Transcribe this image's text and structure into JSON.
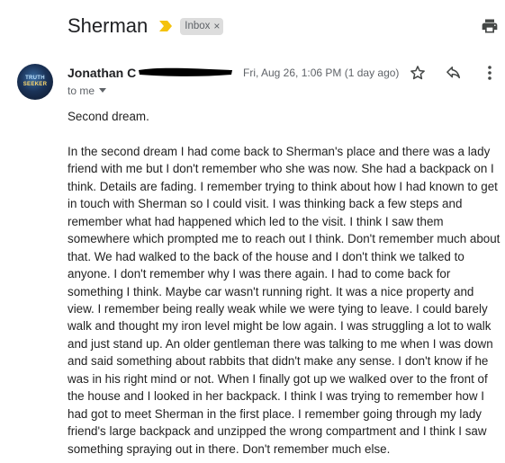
{
  "email": {
    "subject": "Sherman",
    "label": "Inbox",
    "label_remove": "×",
    "sender": "Jonathan C",
    "date": "Fri, Aug 26, 1:06 PM (1 day ago)",
    "recipient": "to me",
    "avatar_text_line1": "TRUTH",
    "avatar_text_line2": "SEEKER",
    "body_intro": "Second dream.",
    "body_main": "In the second dream I had come back to Sherman's place and there was a lady friend with me but I don't remember who she was now. She had a backpack on I think. Details are fading. I remember trying to think about how I had known to get in touch with Sherman so I could visit. I was thinking back a few steps and remember what had happened which led to the visit. I think I saw them somewhere which prompted me to reach out I think. Don't remember much about that. We had walked to the back of the house and I don't think we talked to anyone. I don't remember why I was there again. I had to come back for something I think. Maybe car wasn't running right. It was a nice property and view. I remember being really weak while we were tying to leave. I could barely walk and thought my iron level might be low again. I was struggling a lot to walk and just stand up. An older gentleman there was talking to me when I was down and said something about rabbits that didn't make any sense. I don't know if he was in his right mind or not. When I finally got up we walked over to the front of the house and I looked in her backpack. I think I was trying to remember how I had got to meet Sherman in the first place. I remember going through my lady friend's large backpack and unzipped the wrong compartment and I think I saw something spraying out in there. Don't remember much else."
  },
  "icons": {
    "important": "important-marker-icon",
    "print": "print-icon",
    "star": "star-icon",
    "reply": "reply-icon",
    "more": "more-vert-icon",
    "caret": "caret-down-icon"
  },
  "colors": {
    "important_marker": "#f4c20d",
    "label_chip_bg": "#dddddd",
    "secondary_text": "#5f6368"
  }
}
